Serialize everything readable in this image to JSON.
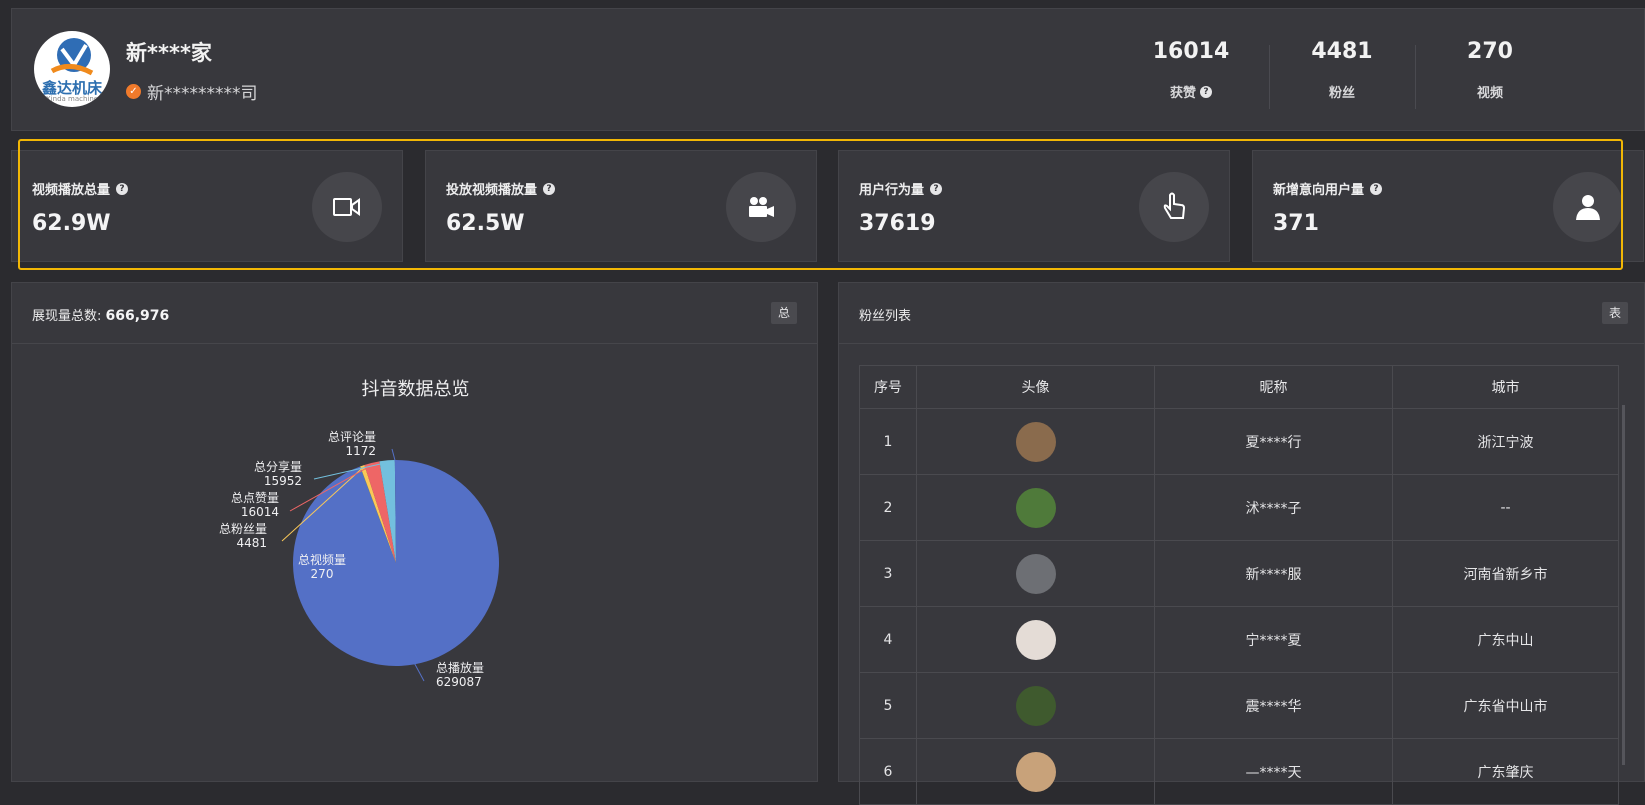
{
  "profile": {
    "name": "新****家",
    "company": "新*********司",
    "logo_text": "鑫达机床",
    "logo_sub": "Xinda machine",
    "stats": [
      {
        "value": "16014",
        "label": "获赞",
        "help": true
      },
      {
        "value": "4481",
        "label": "粉丝",
        "help": false
      },
      {
        "value": "270",
        "label": "视频",
        "help": false
      }
    ]
  },
  "metrics": [
    {
      "label": "视频播放总量",
      "value": "62.9W",
      "icon": "video-camera-icon"
    },
    {
      "label": "投放视频播放量",
      "value": "62.5W",
      "icon": "movie-camera-icon"
    },
    {
      "label": "用户行为量",
      "value": "37619",
      "icon": "hand-pointer-icon"
    },
    {
      "label": "新增意向用户量",
      "value": "371",
      "icon": "user-icon"
    }
  ],
  "impressions": {
    "label": "展现量总数: ",
    "total": "666,976",
    "button": "总"
  },
  "fans": {
    "title": "粉丝列表",
    "button": "表",
    "columns": [
      "序号",
      "头像",
      "昵称",
      "城市"
    ],
    "rows": [
      {
        "index": "1",
        "nickname": "夏****行",
        "city": "浙江宁波",
        "avatar_color": "#8a6b4d"
      },
      {
        "index": "2",
        "nickname": "沭****子",
        "city": "--",
        "avatar_color": "#4f7a3a"
      },
      {
        "index": "3",
        "nickname": "新****服",
        "city": "河南省新乡市",
        "avatar_color": "#6d6f74"
      },
      {
        "index": "4",
        "nickname": "宁****夏",
        "city": "广东中山",
        "avatar_color": "#e4dcd6"
      },
      {
        "index": "5",
        "nickname": "震****华",
        "city": "广东省中山市",
        "avatar_color": "#3f5a2e"
      },
      {
        "index": "6",
        "nickname": "—****天",
        "city": "广东肇庆",
        "avatar_color": "#c8a27a"
      }
    ]
  },
  "chart_data": {
    "type": "pie",
    "title": "抖音数据总览",
    "colors": [
      "#5470c6",
      "#91cc75",
      "#fac858",
      "#ee6666",
      "#73c0de"
    ],
    "slices": [
      {
        "name": "总播放量",
        "value": 629087
      },
      {
        "name": "总视频量",
        "value": 270
      },
      {
        "name": "总粉丝量",
        "value": 4481
      },
      {
        "name": "总点赞量",
        "value": 16014
      },
      {
        "name": "总分享量",
        "value": 15952
      },
      {
        "name": "总评论量",
        "value": 1172
      }
    ]
  }
}
